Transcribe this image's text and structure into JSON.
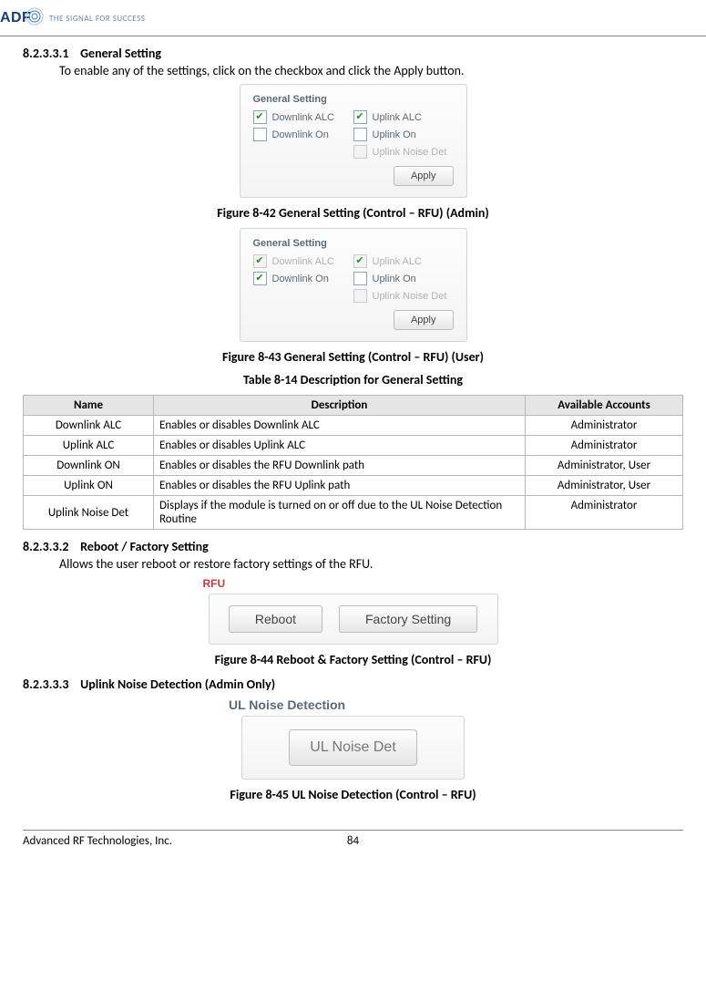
{
  "header": {
    "tagline": "THE SIGNAL FOR SUCCESS"
  },
  "sections": {
    "s1": {
      "num": "8.2.3.3.1",
      "title": "General Setting",
      "text": "To enable any of the settings, click on the checkbox and click the Apply button."
    },
    "s2": {
      "num": "8.2.3.3.2",
      "title": "Reboot / Factory Setting",
      "text": "Allows the user reboot or restore factory settings of the RFU."
    },
    "s3": {
      "num": "8.2.3.3.3",
      "title": "Uplink Noise Detection (Admin Only)"
    }
  },
  "panels": {
    "gs_title": "General Setting",
    "items": {
      "dl_alc": "Downlink ALC",
      "ul_alc": "Uplink ALC",
      "dl_on": "Downlink On",
      "ul_on": "Uplink On",
      "ul_noise": "Uplink Noise Det"
    },
    "apply": "Apply",
    "rfu_title": "RFU",
    "reboot": "Reboot",
    "factory": "Factory Setting",
    "ul_panel_title": "UL Noise Detection",
    "ul_btn": "UL Noise Det"
  },
  "captions": {
    "f42": "Figure 8-42    General Setting (Control – RFU) (Admin)",
    "f43": "Figure 8-43    General Setting (Control – RFU) (User)",
    "t14": "Table 8-14     Description for General Setting",
    "f44": "Figure 8-44    Reboot & Factory Setting (Control – RFU)",
    "f45": "Figure 8-45    UL Noise Detection (Control – RFU)"
  },
  "table": {
    "headers": {
      "name": "Name",
      "desc": "Description",
      "acct": "Available Accounts"
    },
    "rows": [
      {
        "name": "Downlink ALC",
        "desc": "Enables or disables Downlink ALC",
        "acct": "Administrator"
      },
      {
        "name": "Uplink ALC",
        "desc": "Enables or disables Uplink ALC",
        "acct": "Administrator"
      },
      {
        "name": "Downlink ON",
        "desc": "Enables or disables the RFU Downlink path",
        "acct": "Administrator, User"
      },
      {
        "name": "Uplink ON",
        "desc": "Enables or disables the RFU Uplink path",
        "acct": "Administrator, User"
      },
      {
        "name": "Uplink Noise Det",
        "desc": "Displays if the module is turned on or off due to the UL Noise Detection Routine",
        "acct": "Administrator"
      }
    ]
  },
  "footer": {
    "company": "Advanced RF Technologies, Inc.",
    "page": "84"
  }
}
